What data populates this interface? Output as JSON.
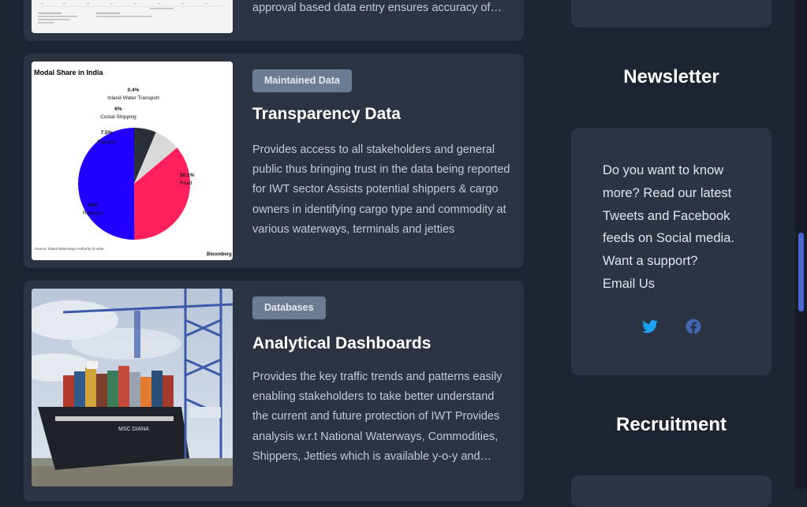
{
  "cards": [
    {
      "desc": "approval based data entry ensures accuracy of data entered thereby improving reliability of data",
      "thumb_alt": "top-card-thumbnail"
    },
    {
      "tag": "Maintained Data",
      "title": "Transparency Data",
      "desc": "Provides access to all stakeholders and general public thus bringing trust in the data being reported for IWT sector Assists potential shippers & cargo owners in identifying cargo type and commodity at various waterways, terminals and jetties",
      "chart_title": "Modal Share in India",
      "chart_source": "Source: Inland Waterways Authority of India",
      "chart_brand": "Bloomberg",
      "chart_data": {
        "type": "pie",
        "title": "Modal Share in India",
        "slices": [
          {
            "label": "Inland Water Transport",
            "value": 0.4,
            "display": "0.4%",
            "color": "#222222"
          },
          {
            "label": "Costal Shipping",
            "value": 6,
            "display": "6%",
            "color": "#2a2f3a"
          },
          {
            "label": "Pipeline",
            "value": 7.5,
            "display": "7.5%",
            "color": "#d9d9d9"
          },
          {
            "label": "Railways",
            "value": 36,
            "display": "36%",
            "color": "#ff1f5a"
          },
          {
            "label": "Road",
            "value": 50.1,
            "display": "50.1%",
            "color": "#2200ff"
          }
        ]
      }
    },
    {
      "tag": "Databases",
      "title": "Analytical Dashboards",
      "desc": "Provides the key traffic trends and patterns easily enabling stakeholders to take better understand the current and future protection of IWT Provides analysis w.r.t National Waterways, Commodities, Shippers, Jetties which is available y-o-y and month wise",
      "ship_name": "MSC DIANA"
    }
  ],
  "sidebar": {
    "newsletter_heading": "Newsletter",
    "newsletter_text": "Do you want to know more? Read our latest Tweets and Facebook feeds on Social media. Want a support?",
    "email_link": "Email Us",
    "recruitment_heading": "Recruitment"
  },
  "social": [
    {
      "name": "twitter-icon",
      "color": "#1da1f2"
    },
    {
      "name": "facebook-icon",
      "color": "#4267b2"
    }
  ]
}
